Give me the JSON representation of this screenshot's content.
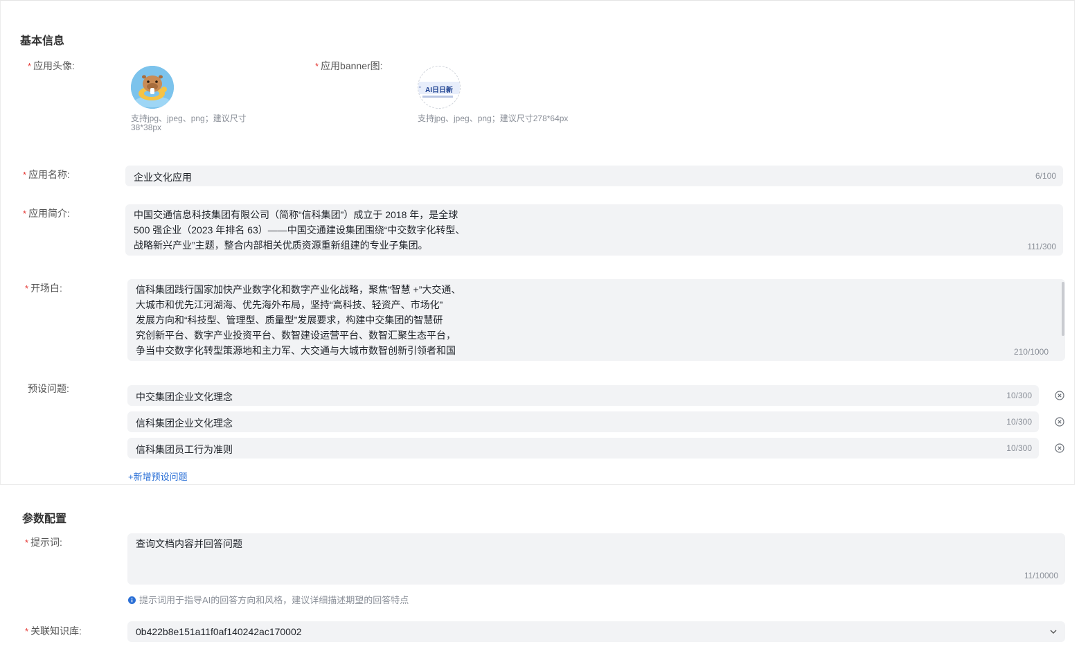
{
  "basic": {
    "title": "基本信息",
    "avatar_label": "应用头像:",
    "avatar_hint_line1": "支持jpg、jpeg、png；建议尺寸",
    "avatar_hint_line2": "38*38px",
    "banner_label": "应用banner图:",
    "banner_text_main": "AI日日新",
    "banner_text_prefix": "· ",
    "banner_hint": "支持jpg、jpeg、png；建议尺寸278*64px",
    "name_label": "应用名称:",
    "name_value": "企业文化应用",
    "name_count": "6/100",
    "intro_label": "应用简介:",
    "intro_lines": [
      "中国交通信息科技集团有限公司（简称“信科集团”）成立于 2018 年，是全球",
      "500 强企业（2023 年排名 63）——中国交通建设集团围绕“中交数字化转型、",
      "战略新兴产业”主题，整合内部相关优质资源重新组建的专业子集团。"
    ],
    "intro_count": "111/300",
    "opening_label": "开场白:",
    "opening_lines": [
      "信科集团践行国家加快产业数字化和数字产业化战略，聚焦“智慧 +”大交通、",
      "大城市和优先江河湖海、优先海外布局，坚持“高科技、轻资产、市场化”",
      "发展方向和“科技型、管理型、质量型”发展要求，构建中交集团的智慧研",
      "究创新平台、数字产业投资平台、数智建设运营平台、数智汇聚生态平台，",
      "争当中交数字化转型策源地和主力军、大交通与大城市数智创新引领者和国"
    ],
    "opening_count": "210/1000",
    "preset_label": "预设问题:",
    "presets": [
      {
        "value": "中交集团企业文化理念",
        "count": "10/300"
      },
      {
        "value": "信科集团企业文化理念",
        "count": "10/300"
      },
      {
        "value": "信科集团员工行为准则",
        "count": "10/300"
      }
    ],
    "add_preset": "+新增预设问题"
  },
  "params": {
    "title": "参数配置",
    "prompt_label": "提示词:",
    "prompt_value": "查询文档内容并回答问题",
    "prompt_count": "11/10000",
    "prompt_tip": "提示词用于指导AI的回答方向和风格，建议详细描述期望的回答特点",
    "kb_label": "关联知识库:",
    "kb_value": "0b422b8e151a11f0af140242ac170002"
  },
  "colors": {
    "required": "#e53935",
    "field_bg": "#f2f3f5",
    "link": "#2a6fd6",
    "avatar_bg": "#6ab7e8"
  },
  "icons": {
    "remove": "close-circle-icon",
    "info": "info-icon",
    "dropdown": "chevron-down-icon"
  }
}
